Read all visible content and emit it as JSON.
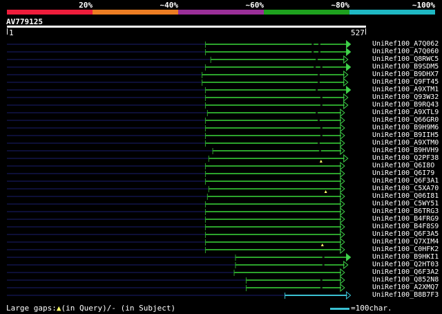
{
  "identity_legend": {
    "labels": [
      "20%",
      "~40%",
      "~60%",
      "~80%",
      "~100%"
    ],
    "colors": [
      "#ee1d3b",
      "#ec7d23",
      "#9a2f98",
      "#1ea11e",
      "#1fb8c4"
    ]
  },
  "query": {
    "id": "AV779125",
    "start_label": "1",
    "end_label": "527",
    "length": 527
  },
  "hits": [
    {
      "name": "UniRef100_A7Q062",
      "start": 297,
      "end": 509,
      "gaps": [
        {
          "pos": 457
        },
        {
          "pos": 467
        }
      ],
      "arrow": "filled",
      "marker": null
    },
    {
      "name": "UniRef100_A7Q060",
      "start": 297,
      "end": 509,
      "gaps": [
        {
          "pos": 457
        },
        {
          "pos": 467
        }
      ],
      "arrow": "filled",
      "marker": null
    },
    {
      "name": "UniRef100_Q8RWC5",
      "start": 305,
      "end": 505,
      "gaps": [
        {
          "pos": 463
        }
      ],
      "arrow": "open",
      "marker": null
    },
    {
      "name": "UniRef100_B9SDM5",
      "start": 297,
      "end": 509,
      "gaps": [
        {
          "pos": 460
        },
        {
          "pos": 470
        }
      ],
      "arrow": "filled",
      "marker": null
    },
    {
      "name": "UniRef100_B9DHX7",
      "start": 292,
      "end": 505,
      "gaps": [
        {
          "pos": 466
        }
      ],
      "arrow": "open",
      "marker": null
    },
    {
      "name": "UniRef100_Q9FT45",
      "start": 292,
      "end": 505,
      "gaps": [
        {
          "pos": 466
        }
      ],
      "arrow": "open",
      "marker": null
    },
    {
      "name": "UniRef100_A9XTM1",
      "start": 297,
      "end": 509,
      "gaps": [
        {
          "pos": 463
        }
      ],
      "arrow": "filled",
      "marker": null
    },
    {
      "name": "UniRef100_Q93W32",
      "start": 297,
      "end": 505,
      "gaps": [
        {
          "pos": 470
        }
      ],
      "arrow": "open",
      "marker": null
    },
    {
      "name": "UniRef100_B9RQ43",
      "start": 297,
      "end": 505,
      "gaps": [
        {
          "pos": 470
        }
      ],
      "arrow": "open",
      "marker": null
    },
    {
      "name": "UniRef100_A9XTL9",
      "start": 300,
      "end": 500,
      "gaps": [
        {
          "pos": 463
        }
      ],
      "arrow": "open",
      "marker": null
    },
    {
      "name": "UniRef100_Q66GR0",
      "start": 297,
      "end": 500,
      "gaps": [
        {
          "pos": 466
        }
      ],
      "arrow": "open",
      "marker": null
    },
    {
      "name": "UniRef100_B9H9M6",
      "start": 297,
      "end": 500,
      "gaps": [
        {
          "pos": 470
        }
      ],
      "arrow": "open",
      "marker": null
    },
    {
      "name": "UniRef100_B9IIH5",
      "start": 297,
      "end": 500,
      "gaps": [
        {
          "pos": 470
        }
      ],
      "arrow": "open",
      "marker": null
    },
    {
      "name": "UniRef100_A9XTM0",
      "start": 297,
      "end": 500,
      "gaps": [
        {
          "pos": 466
        }
      ],
      "arrow": "open",
      "marker": null
    },
    {
      "name": "UniRef100_B9HVH9",
      "start": 308,
      "end": 500,
      "gaps": [
        {
          "pos": 468
        }
      ],
      "arrow": "open",
      "marker": null
    },
    {
      "name": "UniRef100_Q2PF38",
      "start": 302,
      "end": 505,
      "gaps": [],
      "arrow": "open",
      "marker": 470
    },
    {
      "name": "UniRef100_Q6I8O",
      "start": 297,
      "end": 500,
      "gaps": [],
      "arrow": "open",
      "marker": null
    },
    {
      "name": "UniRef100_Q6I79",
      "start": 297,
      "end": 500,
      "gaps": [],
      "arrow": "open",
      "marker": null
    },
    {
      "name": "UniRef100_Q6F3A1",
      "start": 297,
      "end": 500,
      "gaps": [],
      "arrow": "open",
      "marker": null
    },
    {
      "name": "UniRef100_C5XA70",
      "start": 302,
      "end": 500,
      "gaps": [],
      "arrow": "open",
      "marker": 477
    },
    {
      "name": "UniRef100_Q06I81",
      "start": 300,
      "end": 500,
      "gaps": [],
      "arrow": "open",
      "marker": null
    },
    {
      "name": "UniRef100_C5WY51",
      "start": 297,
      "end": 500,
      "gaps": [],
      "arrow": "open",
      "marker": null
    },
    {
      "name": "UniRef100_B6TRG3",
      "start": 297,
      "end": 500,
      "gaps": [],
      "arrow": "open",
      "marker": null
    },
    {
      "name": "UniRef100_B4FRG9",
      "start": 297,
      "end": 500,
      "gaps": [],
      "arrow": "open",
      "marker": null
    },
    {
      "name": "UniRef100_B4F8S9",
      "start": 297,
      "end": 500,
      "gaps": [],
      "arrow": "open",
      "marker": null
    },
    {
      "name": "UniRef100_Q6F3A5",
      "start": 297,
      "end": 500,
      "gaps": [],
      "arrow": "open",
      "marker": null
    },
    {
      "name": "UniRef100_Q7XIM4",
      "start": 297,
      "end": 500,
      "gaps": [],
      "arrow": "open",
      "marker": 472
    },
    {
      "name": "UniRef100_C0HFK2",
      "start": 297,
      "end": 500,
      "gaps": [],
      "arrow": "open",
      "marker": null
    },
    {
      "name": "UniRef100_B9HKI1",
      "start": 342,
      "end": 509,
      "gaps": [
        {
          "pos": 473
        }
      ],
      "arrow": "filled",
      "marker": null
    },
    {
      "name": "UniRef100_Q2HT03",
      "start": 342,
      "end": 505,
      "gaps": [
        {
          "pos": 473
        }
      ],
      "arrow": "open",
      "marker": null
    },
    {
      "name": "UniRef100_Q6F3A2",
      "start": 340,
      "end": 500,
      "gaps": [],
      "arrow": "open",
      "marker": null
    },
    {
      "name": "UniRef100_Q852N8",
      "start": 358,
      "end": 500,
      "gaps": [
        {
          "pos": 470
        }
      ],
      "arrow": "open",
      "marker": null
    },
    {
      "name": "UniRef100_A2XMQ7",
      "start": 358,
      "end": 500,
      "gaps": [
        {
          "pos": 470
        }
      ],
      "arrow": "open",
      "marker": null
    },
    {
      "name": "UniRef100_B8B7F3",
      "start": 416,
      "end": 509,
      "gaps": [],
      "arrow": "open-cyan",
      "marker": null
    }
  ],
  "footer": {
    "legend_prefix": "Large gaps:",
    "legend_triangle": "▲",
    "legend_middle": "(in Query)/",
    "legend_dash": "-",
    "legend_suffix": " (in Subject)",
    "scale_key": "=100char."
  },
  "colors": {
    "hit_line": "#2ca32c",
    "hit_end": "#3fd24a",
    "backbone": "#1a1e6e",
    "marker": "#ffff66",
    "cyan": "#3bc1d3"
  }
}
